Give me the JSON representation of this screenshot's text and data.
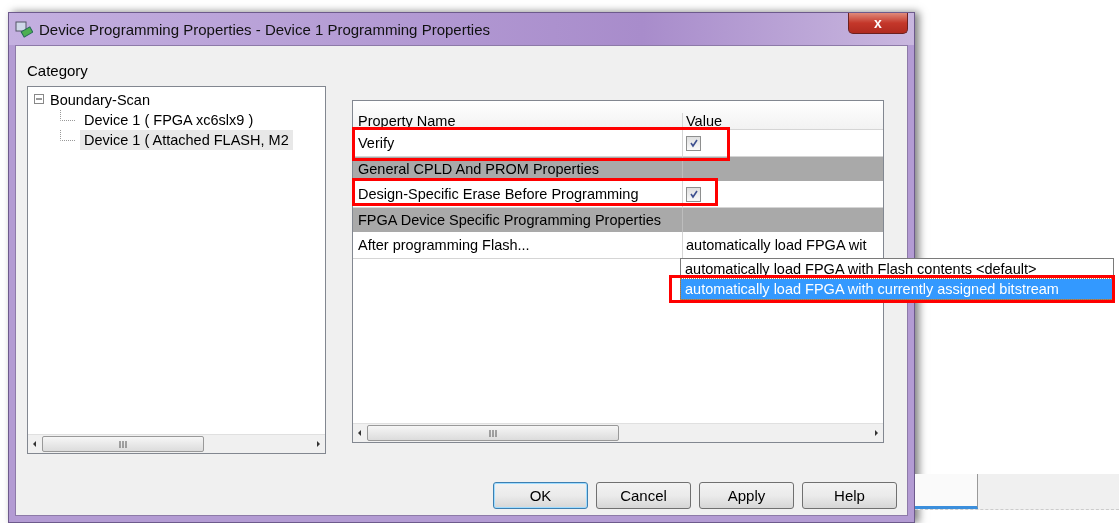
{
  "window": {
    "title": "Device Programming Properties - Device 1 Programming Properties",
    "close_label": "x"
  },
  "category": {
    "label": "Category",
    "tree": [
      {
        "label": "Boundary-Scan",
        "expanded": true,
        "selected": false,
        "children": [
          {
            "label": "Device 1 ( FPGA xc6slx9 )",
            "selected": false
          },
          {
            "label": "Device 1 ( Attached FLASH, M2",
            "selected": true
          }
        ]
      }
    ]
  },
  "property_grid": {
    "columns": [
      "Property Name",
      "Value"
    ],
    "rows": [
      {
        "kind": "check",
        "name": "Verify",
        "checked": true,
        "highlighted": true
      },
      {
        "kind": "category",
        "name": "General CPLD And PROM Properties"
      },
      {
        "kind": "check",
        "name": "Design-Specific Erase Before Programming",
        "checked": true,
        "highlighted": true
      },
      {
        "kind": "category",
        "name": "FPGA Device Specific Programming Properties"
      },
      {
        "kind": "combo",
        "name": "After programming Flash...",
        "value": "automatically load FPGA wit",
        "options": [
          {
            "label": "automatically load FPGA with Flash contents <default>",
            "selected": false,
            "highlighted": false
          },
          {
            "label": "automatically load FPGA with currently assigned bitstream",
            "selected": true,
            "highlighted": true
          }
        ]
      }
    ]
  },
  "buttons": [
    {
      "label": "OK",
      "default": true
    },
    {
      "label": "Cancel",
      "default": false
    },
    {
      "label": "Apply",
      "default": false
    },
    {
      "label": "Help",
      "default": false
    }
  ]
}
